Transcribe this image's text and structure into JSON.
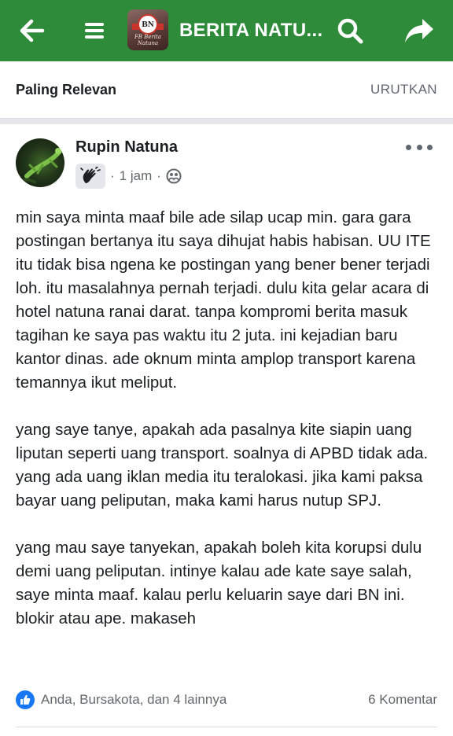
{
  "topbar": {
    "title": "BERITA NATU...",
    "logo_badge": "BN",
    "logo_script": "FB Berita Natuna",
    "icons": [
      "back-arrow-icon",
      "hamburger-menu-icon",
      "search-icon",
      "share-icon"
    ],
    "color": "#2e8b3a"
  },
  "sortbar": {
    "label": "Paling Relevan",
    "action": "URUTKAN"
  },
  "post": {
    "author": "Rupin Natuna",
    "time": "1 jam",
    "dot": "·",
    "privacy_icon": "group-members-icon",
    "paragraphs": [
      "min saya minta maaf bile ade silap ucap min. gara gara postingan bertanya itu saya dihujat habis habisan. UU ITE itu tidak bisa ngena ke postingan yang bener bener terjadi loh. itu masalahnya pernah terjadi. dulu kita gelar acara di hotel natuna ranai darat. tanpa kompromi berita masuk tagihan ke saya pas waktu itu 2 juta. ini kejadian baru kantor dinas. ade oknum minta amplop transport karena temannya ikut meliput.",
      "yang saye tanye, apakah ada pasalnya kite siapin uang liputan seperti uang transport. soalnya di APBD tidak ada. yang ada uang iklan media itu teralokasi. jika kami paksa bayar uang peliputan, maka kami harus nutup SPJ.",
      "yang mau saye tanyekan, apakah boleh kita korupsi dulu demi uang peliputan. intinye kalau ade kate saye salah, saye minta maaf. kalau perlu keluarin saye dari BN ini. blokir atau ape. makaseh"
    ],
    "reactions": "Anda, Bursakota, dan 4 lainnya",
    "comments": "6 Komentar",
    "like_color": "#1877f2"
  }
}
